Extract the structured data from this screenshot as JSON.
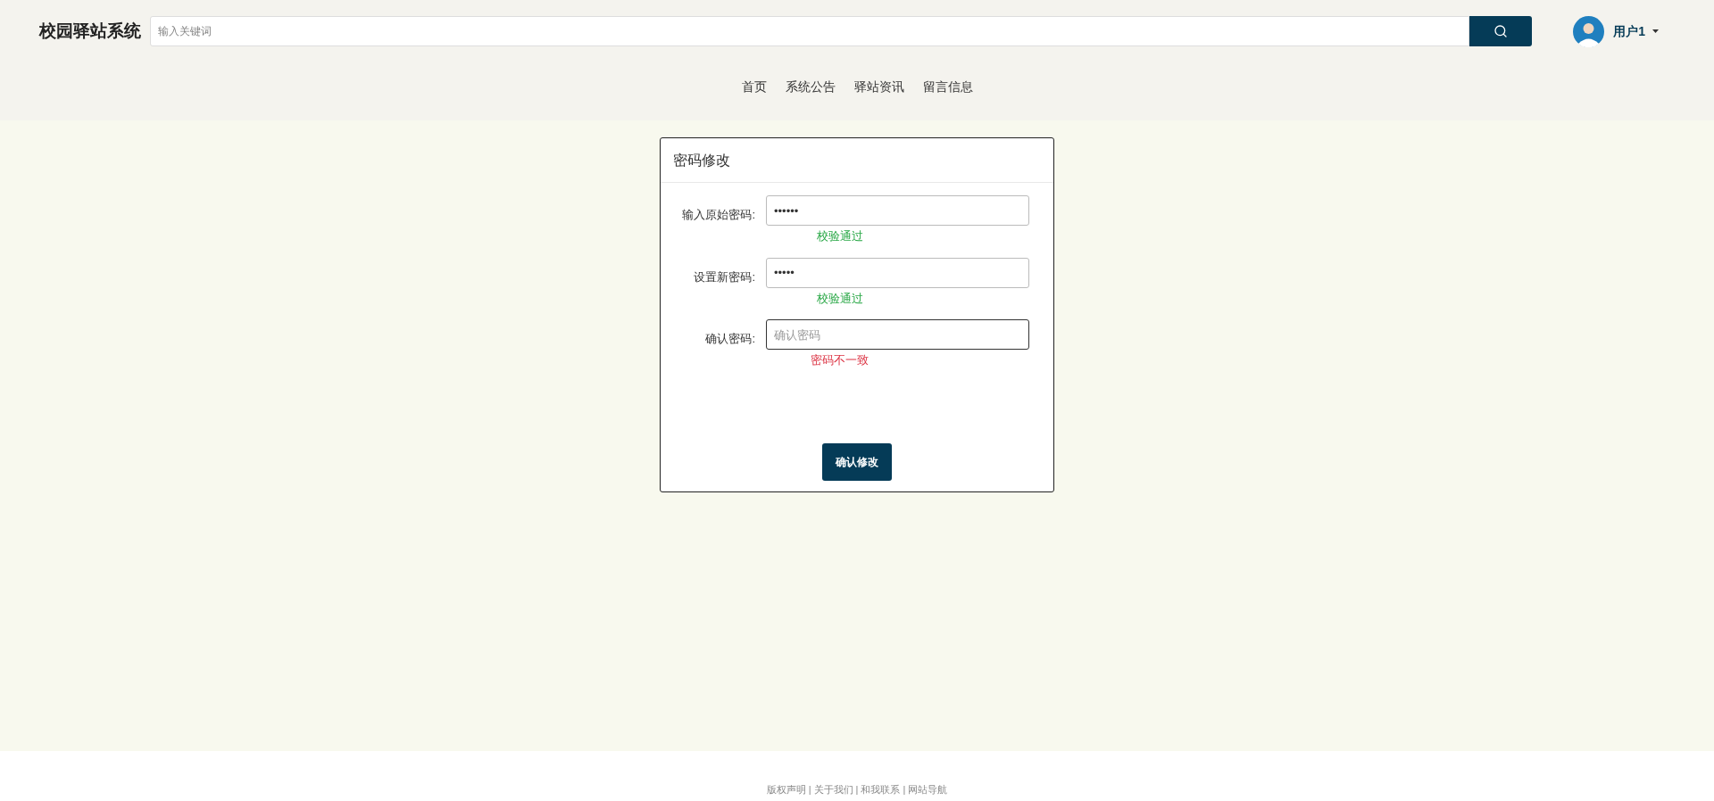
{
  "header": {
    "logo": "校园驿站系统",
    "search": {
      "placeholder": "输入关键词"
    },
    "user": {
      "name": "用户1"
    }
  },
  "nav": [
    {
      "label": "首页"
    },
    {
      "label": "系统公告"
    },
    {
      "label": "驿站资讯"
    },
    {
      "label": "留言信息"
    }
  ],
  "form": {
    "title": "密码修改",
    "fields": [
      {
        "label": "输入原始密码:",
        "value": "••••••",
        "focused": false,
        "message": "校验通过",
        "kind": "ok"
      },
      {
        "label": "设置新密码:",
        "value": "•••••",
        "focused": false,
        "message": "校验通过",
        "kind": "ok"
      },
      {
        "label": "确认密码:",
        "placeholder": "确认密码",
        "focused": true,
        "message": "密码不一致",
        "kind": "error"
      }
    ],
    "submit": "确认修改"
  },
  "footer": {
    "links": [
      "版权声明",
      "关于我们",
      "和我联系",
      "网站导航"
    ],
    "separator": "|"
  }
}
